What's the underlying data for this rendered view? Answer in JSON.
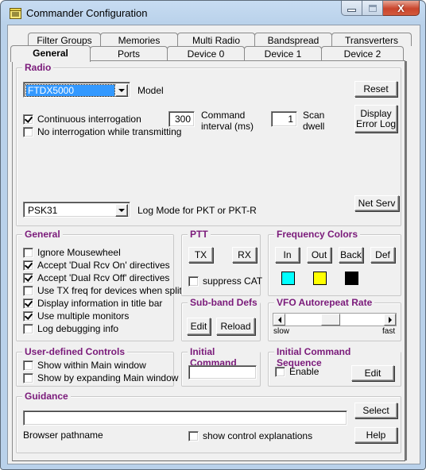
{
  "window": {
    "title": "Commander Configuration",
    "icon": "folder-notebook-icon",
    "controls": {
      "minimize": "minimize-icon",
      "maximize": "maximize-icon",
      "close": "close-icon"
    }
  },
  "tabs": {
    "row1": [
      "Filter Groups",
      "Memories",
      "Multi Radio",
      "Bandspread",
      "Transverters"
    ],
    "row2": [
      "General",
      "Ports",
      "Device 0",
      "Device 1",
      "Device 2"
    ],
    "active": "General"
  },
  "radio": {
    "title": "Radio",
    "model_value": "FTDX5000",
    "model_label": "Model",
    "reset_label": "Reset",
    "continuous_interrogation": {
      "label": "Continuous interrogation",
      "checked": true
    },
    "no_interrogation_tx": {
      "label": "No interrogation while transmitting",
      "checked": false
    },
    "command_interval_value": "300",
    "command_interval_label_1": "Command",
    "command_interval_label_2": "interval (ms)",
    "scan_dwell_value": "1",
    "scan_dwell_label_1": "Scan",
    "scan_dwell_label_2": "dwell",
    "display_error_log_1": "Display",
    "display_error_log_2": "Error Log",
    "log_mode_value": "PSK31",
    "log_mode_label": "Log Mode for PKT or PKT-R",
    "net_serv_label": "Net Serv"
  },
  "general": {
    "title": "General",
    "options": [
      {
        "label": "Ignore Mousewheel",
        "checked": false
      },
      {
        "label": "Accept 'Dual Rcv On' directives",
        "checked": true
      },
      {
        "label": "Accept 'Dual Rcv Off' directives",
        "checked": true
      },
      {
        "label": "Use TX freq for devices when split",
        "checked": false
      },
      {
        "label": "Display information in title bar",
        "checked": true
      },
      {
        "label": "Use multiple monitors",
        "checked": true
      },
      {
        "label": "Log debugging info",
        "checked": false
      }
    ]
  },
  "ptt": {
    "title": "PTT",
    "tx_label": "TX",
    "rx_label": "RX",
    "suppress_cat": {
      "label": "suppress CAT",
      "checked": false
    }
  },
  "frequency_colors": {
    "title": "Frequency Colors",
    "buttons": [
      "In",
      "Out",
      "Back",
      "Def"
    ],
    "swatches": [
      {
        "name": "in-color",
        "color": "#00ffff"
      },
      {
        "name": "out-color",
        "color": "#ffff00"
      },
      {
        "name": "back-color",
        "color": "#000000"
      }
    ]
  },
  "subband": {
    "title": "Sub-band Defs",
    "edit_label": "Edit",
    "reload_label": "Reload"
  },
  "vfo_autorepeat": {
    "title": "VFO Autorepeat Rate",
    "slow_label": "slow",
    "fast_label": "fast",
    "value_fraction": 0.45
  },
  "user_defined": {
    "title": "User-defined Controls",
    "options": [
      {
        "label": "Show within Main window",
        "checked": false
      },
      {
        "label": "Show by expanding Main window",
        "checked": false
      }
    ]
  },
  "initial_command": {
    "title": "Initial Command",
    "value": ""
  },
  "initial_sequence": {
    "title": "Initial Command Sequence",
    "enable": {
      "label": "Enable",
      "checked": false
    },
    "edit_label": "Edit"
  },
  "guidance": {
    "title": "Guidance",
    "browser_path_value": "",
    "browser_path_label": "Browser pathname",
    "select_label": "Select",
    "show_explanations": {
      "label": "show control explanations",
      "checked": false
    },
    "help_label": "Help"
  }
}
